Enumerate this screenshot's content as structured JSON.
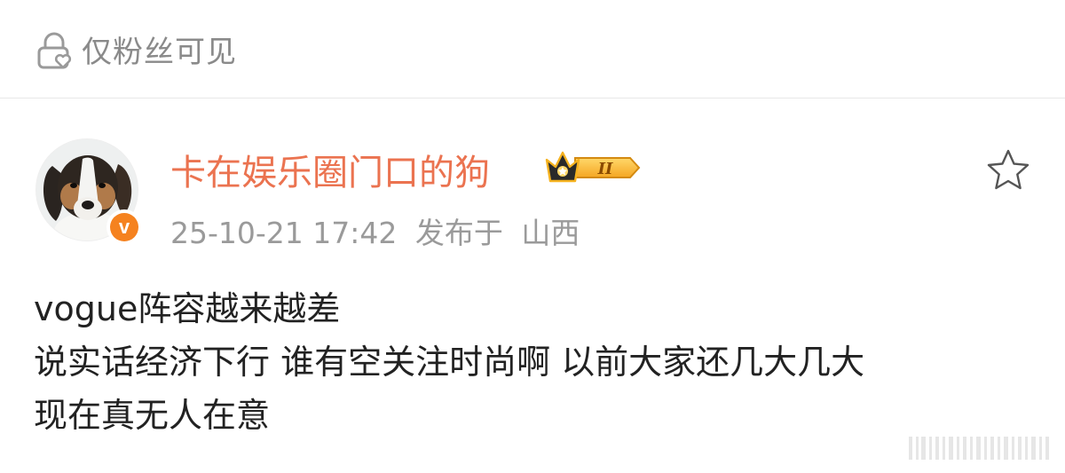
{
  "visibility": {
    "icon": "lock-heart-icon",
    "label": "仅粉丝可见"
  },
  "post": {
    "author": {
      "name": "卡在娱乐圈门口的狗",
      "avatar_icon": "dog-avatar",
      "verified_badge": "v",
      "level_badge": "II",
      "name_color": "#eb7350"
    },
    "timestamp": "25-10-21 17:42",
    "location_prefix": "发布于",
    "location": "山西",
    "favorite_icon": "star-outline-icon",
    "content_lines": [
      "vogue阵容越来越差",
      "说实话经济下行 谁有空关注时尚啊 以前大家还几大几大",
      "现在真无人在意"
    ]
  },
  "colors": {
    "accent": "#eb7350",
    "verified": "#f5821f",
    "meta_text": "#9a9a9a",
    "body_text": "#222222"
  }
}
